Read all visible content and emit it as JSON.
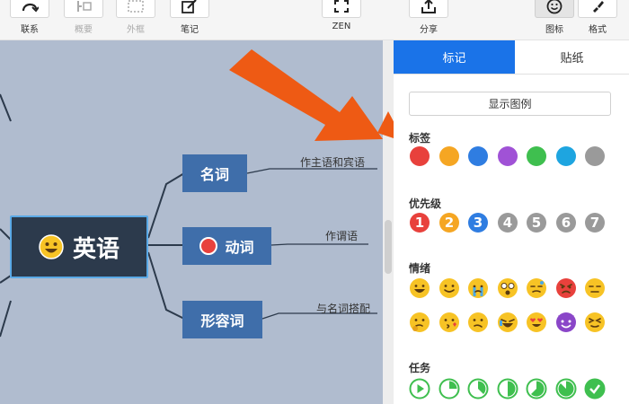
{
  "toolbar": {
    "items": [
      {
        "label": "联系",
        "icon": "relation-icon",
        "enabled": true
      },
      {
        "label": "概要",
        "icon": "summary-icon",
        "enabled": false
      },
      {
        "label": "外框",
        "icon": "boundary-icon",
        "enabled": false
      },
      {
        "label": "笔记",
        "icon": "note-icon",
        "enabled": true
      },
      {
        "label": "ZEN",
        "icon": "zen-icon",
        "enabled": true
      },
      {
        "label": "分享",
        "icon": "share-icon",
        "enabled": true
      },
      {
        "label": "图标",
        "icon": "emoji-icon",
        "enabled": true,
        "active": true
      },
      {
        "label": "格式",
        "icon": "format-brush-icon",
        "enabled": true
      }
    ]
  },
  "mindmap": {
    "root": "英语",
    "nodes": [
      {
        "label": "名词",
        "note": "作主语和宾语"
      },
      {
        "label": "动词",
        "note": "作谓语"
      },
      {
        "label": "形容词",
        "note": "与名词搭配"
      }
    ]
  },
  "panel": {
    "tabs": [
      "标记",
      "贴纸"
    ],
    "legend_button": "显示图例",
    "sections": {
      "labels": "标签",
      "priority": "优先级",
      "emotion": "情绪",
      "task": "任务"
    },
    "label_colors": [
      "#e8413c",
      "#f5a623",
      "#2f7de1",
      "#a052d6",
      "#3fbf4f",
      "#1ea5e0",
      "#9a9a9a"
    ],
    "priority_colors": [
      "#e8413c",
      "#f5a623",
      "#2f7de1",
      "#9a9a9a",
      "#9a9a9a",
      "#9a9a9a",
      "#9a9a9a"
    ],
    "priority_numbers": [
      "1",
      "2",
      "3",
      "4",
      "5",
      "6",
      "7"
    ],
    "task_progress": [
      0,
      0.25,
      0.375,
      0.5,
      0.625,
      0.875,
      1
    ],
    "colors": {
      "accent": "#1a73e8",
      "node": "#3f6eaa",
      "root": "#2c3a4c",
      "canvas": "#b0bccf",
      "task": "#3fbf4f"
    }
  }
}
